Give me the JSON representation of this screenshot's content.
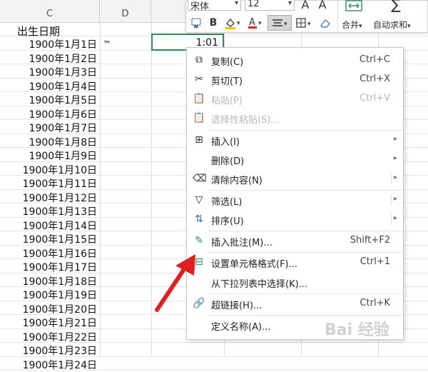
{
  "sheet": {
    "columns": [
      "C",
      "D"
    ],
    "header_cell": "出生日期",
    "tm_mark": "™",
    "active_cell_value": "1:01",
    "dates": [
      "1900年1月1日",
      "1900年1月2日",
      "1900年1月3日",
      "1900年1月4日",
      "1900年1月5日",
      "1900年1月6日",
      "1900年1月7日",
      "1900年1月8日",
      "1900年1月9日",
      "1900年1月10日",
      "1900年1月11日",
      "1900年1月12日",
      "1900年1月13日",
      "1900年1月14日",
      "1900年1月15日",
      "1900年1月16日",
      "1900年1月17日",
      "1900年1月18日",
      "1900年1月19日",
      "1900年1月20日",
      "1900年1月21日",
      "1900年1月22日",
      "1900年1月23日",
      "1900年1月24日"
    ]
  },
  "toolbar": {
    "font_name": "宋体",
    "font_size": "12",
    "bold": "B",
    "font_grow": "A",
    "font_shrink": "A",
    "merge_label": "合并",
    "autosum_label": "自动求和",
    "caret": "▾",
    "font_color_letter": "A"
  },
  "menu": {
    "items": [
      {
        "label": "复制(C)",
        "shortcut": "Ctrl+C",
        "icon": "copy-icon",
        "glyph": "⧉"
      },
      {
        "label": "剪切(T)",
        "shortcut": "Ctrl+X",
        "icon": "scissors-icon",
        "glyph": "✂"
      },
      {
        "label": "粘贴(P)",
        "shortcut": "Ctrl+V",
        "icon": "paste-icon",
        "glyph": "📋"
      },
      {
        "label": "选择性粘贴(S)...",
        "shortcut": "",
        "icon": "paste-special-icon",
        "glyph": "📋"
      },
      {
        "label": "插入(I)",
        "shortcut": "",
        "icon": "insert-icon",
        "glyph": "⊞"
      },
      {
        "label": "删除(D)",
        "shortcut": "",
        "icon": "",
        "glyph": ""
      },
      {
        "label": "清除内容(N)",
        "shortcut": "",
        "icon": "eraser-icon",
        "glyph": "⌫"
      },
      {
        "label": "筛选(L)",
        "shortcut": "",
        "icon": "filter-icon",
        "glyph": "▽"
      },
      {
        "label": "排序(U)",
        "shortcut": "",
        "icon": "sort-icon",
        "glyph": "⇅"
      },
      {
        "label": "插入批注(M)...",
        "shortcut": "Shift+F2",
        "icon": "comment-icon",
        "glyph": "✎"
      },
      {
        "label": "设置单元格格式(F)...",
        "shortcut": "Ctrl+1",
        "icon": "format-cells-icon",
        "glyph": "⊟"
      },
      {
        "label": "从下拉列表中选择(K)...",
        "shortcut": "",
        "icon": "",
        "glyph": ""
      },
      {
        "label": "超链接(H)...",
        "shortcut": "Ctrl+K",
        "icon": "link-icon",
        "glyph": "🔗"
      },
      {
        "label": "定义名称(A)...",
        "shortcut": "",
        "icon": "",
        "glyph": ""
      }
    ],
    "submenu_arrow": "▸"
  },
  "watermark": "Bai 经验",
  "colors": {
    "active_cell_border": "#2e8b57",
    "arrow": "#e02020"
  }
}
